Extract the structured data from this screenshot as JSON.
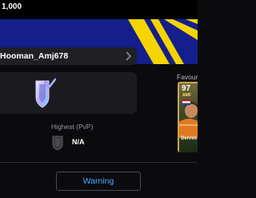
{
  "topbar": {
    "coins": "1,000"
  },
  "profile": {
    "name": "Hooman_Amj678",
    "highest_label": "Highest (PvP)",
    "highest_value": "N/A"
  },
  "favourite": {
    "label": "Favour",
    "card": {
      "rating": "97",
      "position": "AMF",
      "name": "Dennis"
    }
  },
  "footer": {
    "warning_label": "Warning"
  },
  "colors": {
    "banner_blue": "#141e8c",
    "stripe_yellow": "#f5d400",
    "card_border": "#c9a64a",
    "warning_text": "#4aa8ff"
  },
  "icons": {
    "badge": "shield-checkmark-icon",
    "rank": "rank-shield-icon",
    "chevron": "chevron-right-icon"
  }
}
